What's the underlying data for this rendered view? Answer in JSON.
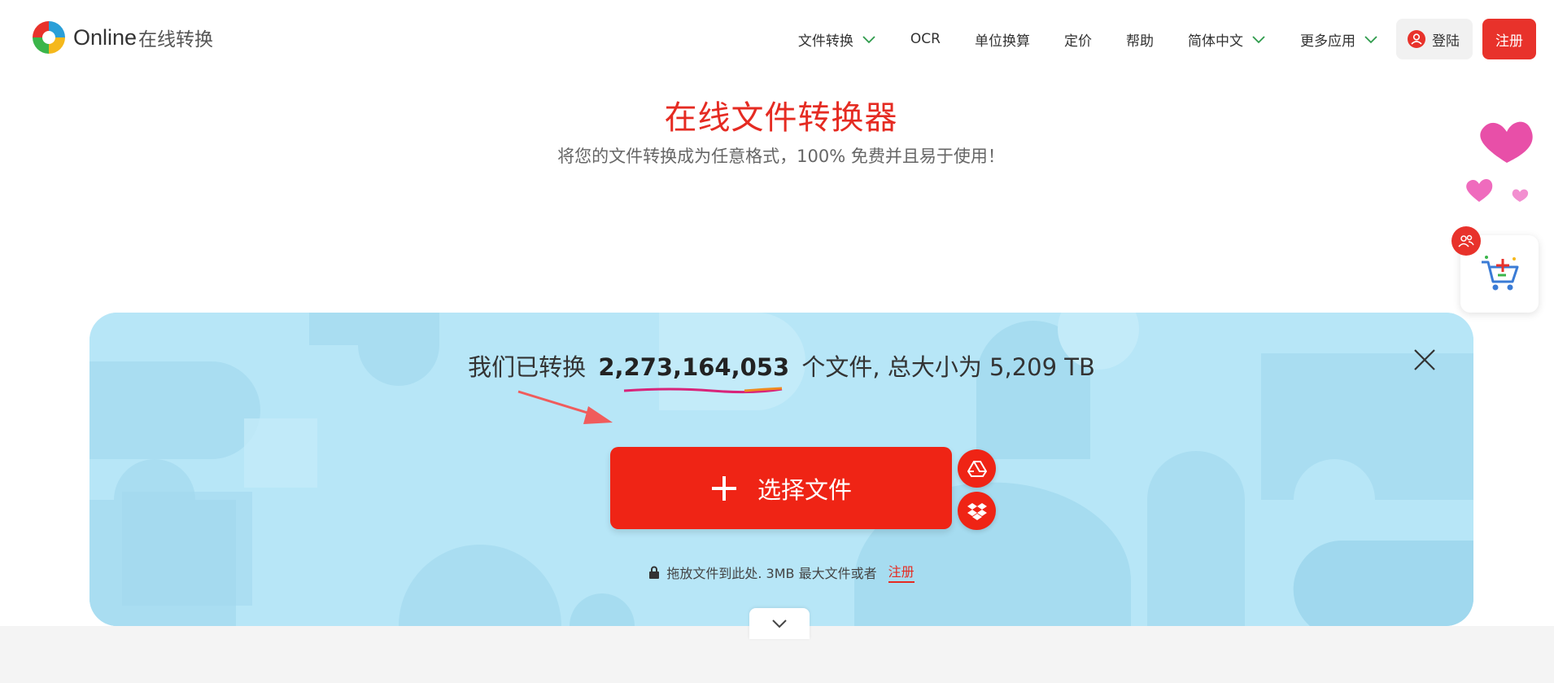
{
  "header": {
    "logo_text": "Online",
    "logo_sub": "在线转换",
    "nav": [
      {
        "label": "文件转换",
        "dropdown": true
      },
      {
        "label": "OCR",
        "dropdown": false
      },
      {
        "label": "单位换算",
        "dropdown": false
      },
      {
        "label": "定价",
        "dropdown": false
      },
      {
        "label": "帮助",
        "dropdown": false
      },
      {
        "label": "简体中文",
        "dropdown": true
      },
      {
        "label": "更多应用",
        "dropdown": true
      }
    ],
    "login_label": "登陆",
    "register_label": "注册"
  },
  "hero": {
    "title": "在线文件转换器",
    "subtitle": "将您的文件转换成为任意格式，100% 免费并且易于使用！"
  },
  "panel": {
    "stats_prefix": "我们已转换",
    "stats_count": "2,273,164,053",
    "stats_suffix": "个文件, 总大小为 5,209 TB",
    "choose_label": "选择文件",
    "drop_hint": "拖放文件到此处. 3MB 最大文件或者",
    "register_link": "注册",
    "cloud_buttons": [
      "google-drive-icon",
      "dropbox-icon"
    ]
  },
  "colors": {
    "accent": "#ef2415",
    "panel_bg": "#b7e6f7",
    "title_red": "#e52b22"
  }
}
